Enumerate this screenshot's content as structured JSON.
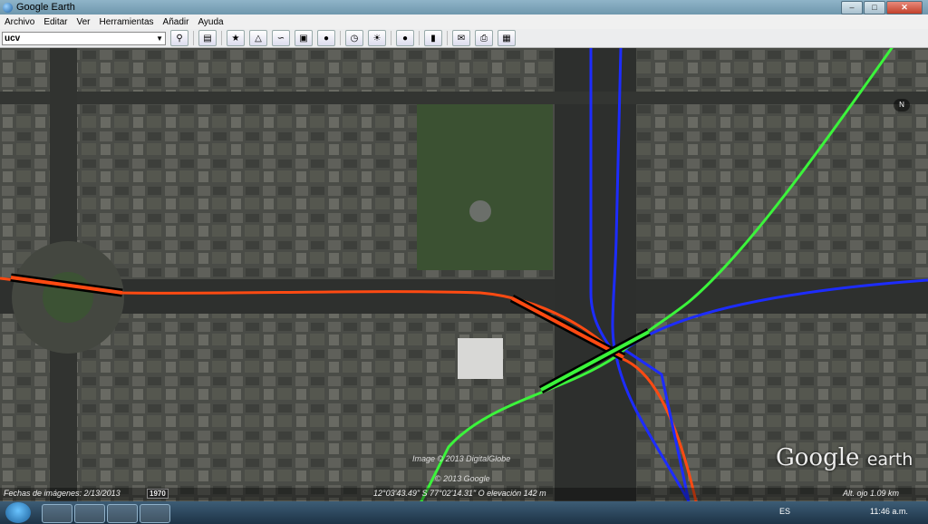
{
  "window": {
    "title": "Google Earth",
    "minimize": "–",
    "maximize": "□",
    "close": "✕"
  },
  "menu": {
    "items": [
      "Archivo",
      "Editar",
      "Ver",
      "Herramientas",
      "Añadir",
      "Ayuda"
    ]
  },
  "search": {
    "value": "ucv"
  },
  "toolbar": {
    "icons": [
      "search-icon",
      "sidebar-icon",
      "placemark-icon",
      "polygon-icon",
      "path-icon",
      "overlay-icon",
      "tour-icon",
      "historical-imagery-icon",
      "sunlight-icon",
      "planets-icon",
      "ruler-icon",
      "email-icon",
      "print-icon",
      "save-image-icon"
    ]
  },
  "map": {
    "credit_line1": "Image © 2013 DigitalGlobe",
    "credit_line2": "© 2013 Google",
    "compass_label": "N",
    "logo_google": "Google",
    "logo_earth": "earth",
    "colors": {
      "orange_line": "#ff4a12",
      "blue_line": "#1d2cff",
      "green_line": "#3bf43b",
      "station": "#000000"
    }
  },
  "status": {
    "imagery_date": "Fechas de imágenes: 2/13/2013",
    "year": "1970",
    "coords": "12°03'43.49\" S  77°02'14.31\" O  elevación  142 m",
    "eye_alt": "Alt. ojo   1.09 km"
  },
  "taskbar": {
    "lang": "ES",
    "time": "11:46 a.m."
  }
}
